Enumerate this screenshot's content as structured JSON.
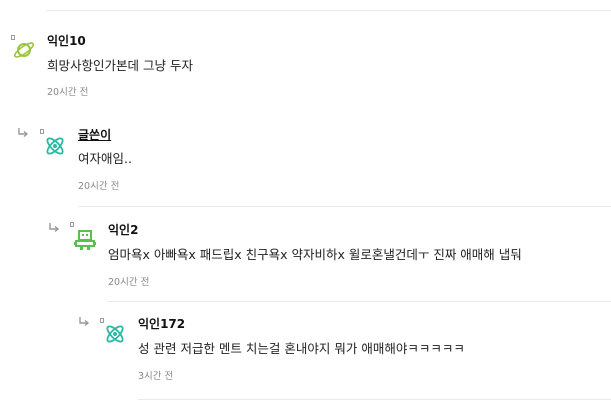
{
  "comments": [
    {
      "nickname": "익인10",
      "text": "희망사항인가본데 그냥 두자",
      "time": "20시간 전",
      "avatar_icon": "planet-icon",
      "avatar_color": "#9bc53d",
      "is_reply": false
    },
    {
      "nickname": "글쓴이",
      "text": "여자애임..",
      "time": "20시간 전",
      "avatar_icon": "atom-icon",
      "avatar_color": "#2bb9a4",
      "is_reply": true,
      "is_author": true
    },
    {
      "nickname": "익인2",
      "text": "엄마욕x 아빠욕x 패드립x 친구욕x 약자비하x 윌로혼낼건데ㅜ 진짜 애매해 냅둬",
      "time": "20시간 전",
      "avatar_icon": "robot-icon",
      "avatar_color": "#57c24a",
      "is_reply": true
    },
    {
      "nickname": "익인172",
      "text": "성 관련 저급한 멘트 치는걸 혼내야지 뭐가 애매해야ㅋㅋㅋㅋㅋ",
      "time": "3시간 전",
      "avatar_icon": "atom-icon",
      "avatar_color": "#2bb9a4",
      "is_reply": true
    }
  ]
}
